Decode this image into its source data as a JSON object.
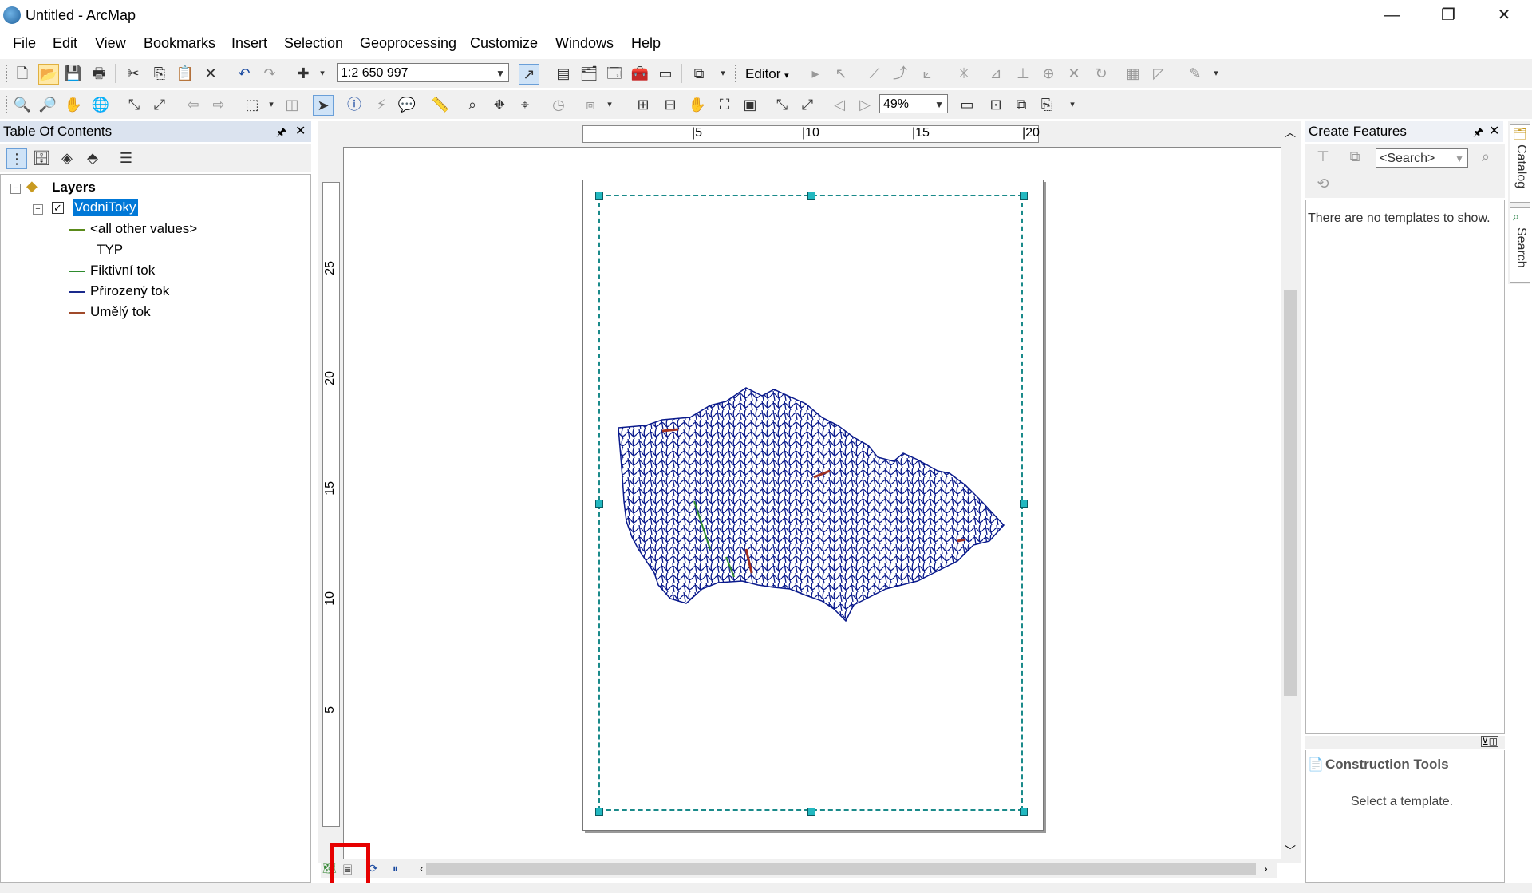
{
  "window": {
    "title": "Untitled - ArcMap",
    "minimize_glyph": "—",
    "restore_glyph": "❐",
    "close_glyph": "✕"
  },
  "menu": [
    "File",
    "Edit",
    "View",
    "Bookmarks",
    "Insert",
    "Selection",
    "Geoprocessing",
    "Customize",
    "Windows",
    "Help"
  ],
  "toolbar": {
    "scale_value": "1:2 650 997",
    "editor_label": "Editor",
    "zoom_value": "49%"
  },
  "toc": {
    "title": "Table Of Contents",
    "pin_glyph": "🖈",
    "close_glyph": "✕",
    "layers_label": "Layers",
    "layer_name": "VodniToky",
    "legend": [
      {
        "label": "<all other values>",
        "color": "#5a8a1a"
      },
      {
        "label": "TYP",
        "color": ""
      },
      {
        "label": "Fiktivní tok",
        "color": "#2e8b2e"
      },
      {
        "label": "Přirozený tok",
        "color": "#1a2a8c"
      },
      {
        "label": "Umělý tok",
        "color": "#a04a2a"
      }
    ]
  },
  "layout": {
    "ruler_top_ticks": [
      "5",
      "10",
      "15",
      "20"
    ],
    "ruler_left_ticks": [
      "25",
      "20",
      "15",
      "10",
      "5"
    ],
    "river_color": "#0a1a8c"
  },
  "create_features": {
    "title": "Create Features",
    "search_placeholder": "<Search>",
    "empty_message": "There are no templates to show.",
    "construction_title": "Construction Tools",
    "construction_message": "Select a template."
  },
  "side_tabs": [
    "Catalog",
    "Search"
  ],
  "colors": {
    "highlight": "#e60000",
    "selection": "#0078d7"
  }
}
